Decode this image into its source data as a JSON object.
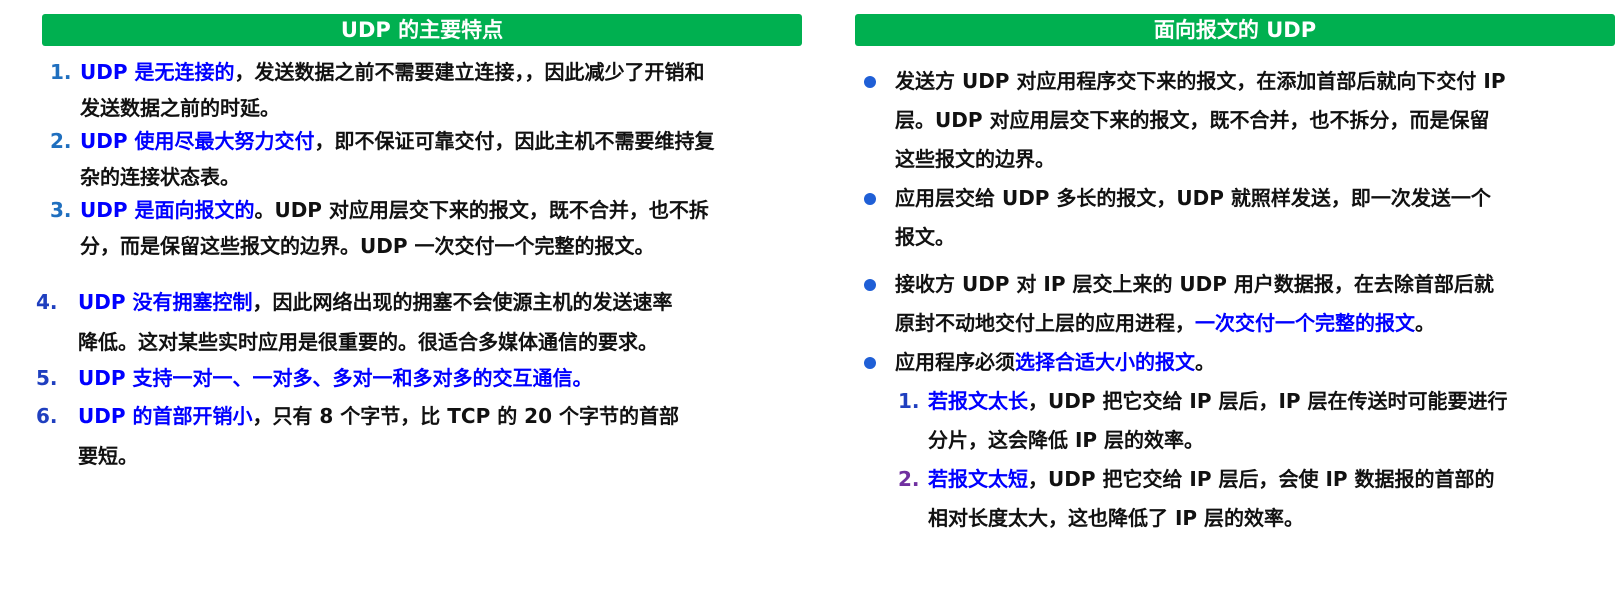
{
  "left": {
    "title": "UDP 的主要特点",
    "items": [
      {
        "num": "1.",
        "hl": "UDP 是无连接的",
        "rest": "，发送数据之前不需要建立连接，，因此减少了开销和",
        "rest2": "发送数据之前的时延。"
      },
      {
        "num": "2.",
        "hl": "UDP 使用尽最大努力交付",
        "rest": "，即不保证可靠交付，因此主机不需要维持复",
        "rest2": "杂的连接状态表。"
      },
      {
        "num": "3.",
        "hl": "UDP 是面向报文的",
        "rest": "。UDP 对应用层交下来的报文，既不合并，也不拆",
        "rest2": "分，而是保留这些报文的边界。UDP 一次交付一个完整的报文。"
      },
      {
        "num": "4.",
        "hl": "UDP 没有拥塞控制",
        "rest": "，因此网络出现的拥塞不会使源主机的发送速率",
        "rest2": "降低。这对某些实时应用是很重要的。很适合多媒体通信的要求。"
      },
      {
        "num": "5.",
        "hl": "UDP 支持一对一、一对多、多对一和多对多的交互通信。"
      },
      {
        "num": "6.",
        "hl": "UDP 的首部开销小",
        "rest": "，只有 8 个字节，比 TCP 的 20 个字节的首部",
        "rest2": "要短。"
      }
    ]
  },
  "right": {
    "title": "面向报文的 UDP",
    "bullets": [
      {
        "l1": "发送方 UDP 对应用程序交下来的报文，在添加首部后就向下交付 IP",
        "l2": "层。UDP 对应用层交下来的报文，既不合并，也不拆分，而是保留",
        "l3": "这些报文的边界。"
      },
      {
        "l1": "应用层交给 UDP 多长的报文，UDP 就照样发送，即一次发送一个",
        "l2": "报文。"
      },
      {
        "l1": "接收方 UDP 对 IP 层交上来的 UDP 用户数据报，在去除首部后就",
        "l2a": "原封不动地交付上层的应用进程，",
        "l2hl": "一次交付一个完整的报文",
        "l2b": "。"
      },
      {
        "l1a": "应用程序必须",
        "l1hl": "选择合适大小的报文",
        "l1b": "。"
      }
    ],
    "sub": [
      {
        "num": "1.",
        "hl": "若报文太长",
        "rest": "，UDP 把它交给 IP 层后，IP 层在传送时可能要进行",
        "rest2": "分片，这会降低 IP 层的效率。"
      },
      {
        "num": "2.",
        "hl": "若报文太短",
        "rest": "，UDP 把它交给 IP 层后，会使 IP 数据报的首部的",
        "rest2": "相对长度太大，这也降低了 IP 层的效率。"
      }
    ]
  },
  "colors": {
    "banner": "#00b050",
    "highlight": "#0000ff",
    "num_a": "#1f6fbf",
    "num_b": "#1f3fbf",
    "sub_num_2": "#7030a0",
    "bullet": "#1f5fd6"
  }
}
